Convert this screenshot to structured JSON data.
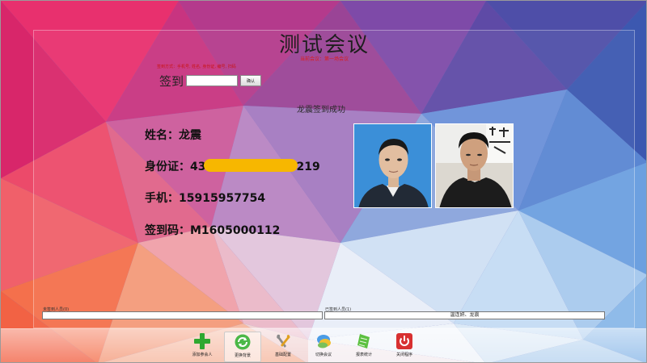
{
  "header": {
    "title": "测试会议",
    "subtitle": "当前会议：第一场会议",
    "hint": "签到方式：手机号, 姓名, 身份证, 编号, 扫码"
  },
  "signin": {
    "label": "签到",
    "input_value": "",
    "confirm_label": "确认"
  },
  "status": {
    "message": "龙震签到成功"
  },
  "attendee": {
    "name_label": "姓名：",
    "name": "龙震",
    "id_label": "身份证：",
    "id_prefix": "43",
    "id_suffix": "219",
    "phone_label": "手机：",
    "phone": "15915957754",
    "code_label": "签到码：",
    "code": "M1605000112"
  },
  "lists": {
    "unsigned_label": "未签到人员(0)",
    "unsigned_value": "",
    "signed_label": "已签到人员(1)",
    "signed_value": "温连妍、龙震"
  },
  "toolbar": {
    "items": [
      {
        "label": "添加参会人",
        "icon": "plus-icon",
        "color": "#2fa82f"
      },
      {
        "label": "更换背景",
        "icon": "refresh-icon",
        "color": "#3aa83a"
      },
      {
        "label": "基础配置",
        "icon": "tools-icon",
        "color": "#e0a020"
      },
      {
        "label": "切换会议",
        "icon": "switch-icon",
        "color": "#3a8ee0"
      },
      {
        "label": "报表统计",
        "icon": "report-icon",
        "color": "#5cc040"
      },
      {
        "label": "关闭程序",
        "icon": "power-icon",
        "color": "#d83030"
      }
    ]
  }
}
